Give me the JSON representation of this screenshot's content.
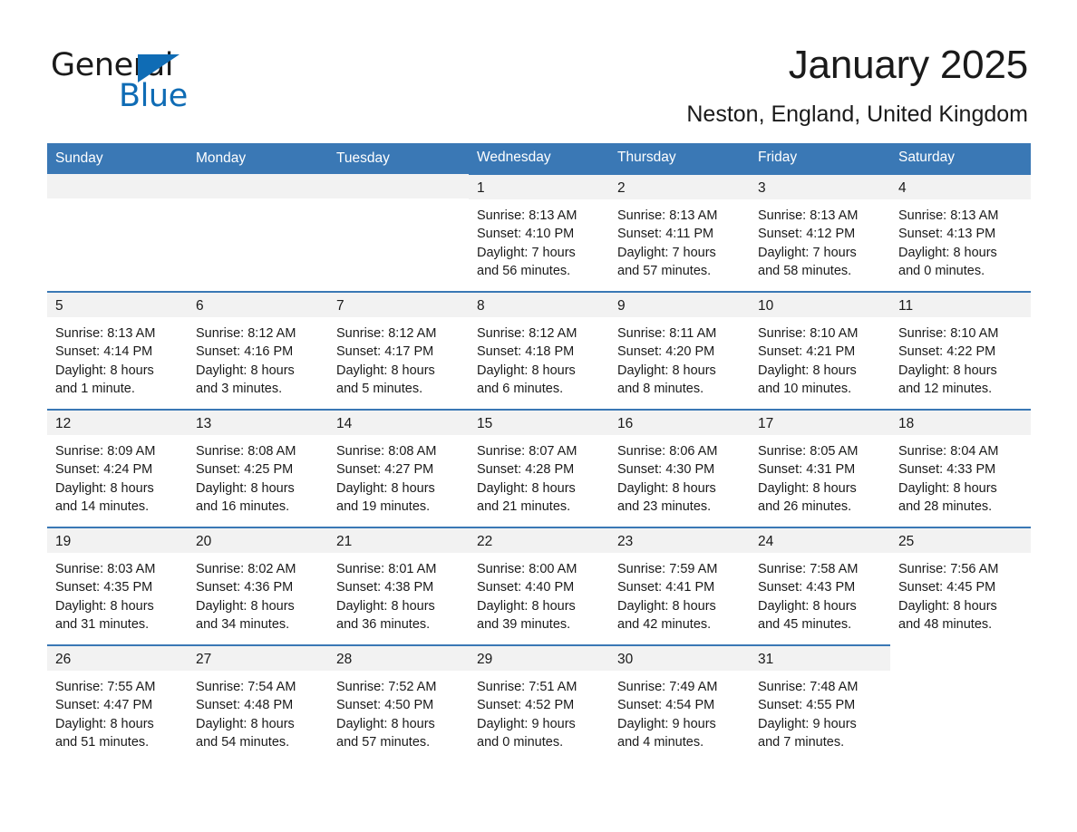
{
  "brand": {
    "name_part1": "General",
    "name_part2": "Blue",
    "triangle_color": "#0f6cb5"
  },
  "header": {
    "title": "January 2025",
    "subtitle": "Neston, England, United Kingdom"
  },
  "theme": {
    "header_blue": "#3a78b5",
    "daynum_band": "#f2f2f2",
    "text": "#1a1a1a"
  },
  "weekday_headers": [
    "Sunday",
    "Monday",
    "Tuesday",
    "Wednesday",
    "Thursday",
    "Friday",
    "Saturday"
  ],
  "weeks": [
    [
      {
        "blank": true
      },
      {
        "blank": true
      },
      {
        "blank": true
      },
      {
        "day": "1",
        "sunrise": "Sunrise: 8:13 AM",
        "sunset": "Sunset: 4:10 PM",
        "daylight1": "Daylight: 7 hours",
        "daylight2": "and 56 minutes."
      },
      {
        "day": "2",
        "sunrise": "Sunrise: 8:13 AM",
        "sunset": "Sunset: 4:11 PM",
        "daylight1": "Daylight: 7 hours",
        "daylight2": "and 57 minutes."
      },
      {
        "day": "3",
        "sunrise": "Sunrise: 8:13 AM",
        "sunset": "Sunset: 4:12 PM",
        "daylight1": "Daylight: 7 hours",
        "daylight2": "and 58 minutes."
      },
      {
        "day": "4",
        "sunrise": "Sunrise: 8:13 AM",
        "sunset": "Sunset: 4:13 PM",
        "daylight1": "Daylight: 8 hours",
        "daylight2": "and 0 minutes."
      }
    ],
    [
      {
        "day": "5",
        "sunrise": "Sunrise: 8:13 AM",
        "sunset": "Sunset: 4:14 PM",
        "daylight1": "Daylight: 8 hours",
        "daylight2": "and 1 minute."
      },
      {
        "day": "6",
        "sunrise": "Sunrise: 8:12 AM",
        "sunset": "Sunset: 4:16 PM",
        "daylight1": "Daylight: 8 hours",
        "daylight2": "and 3 minutes."
      },
      {
        "day": "7",
        "sunrise": "Sunrise: 8:12 AM",
        "sunset": "Sunset: 4:17 PM",
        "daylight1": "Daylight: 8 hours",
        "daylight2": "and 5 minutes."
      },
      {
        "day": "8",
        "sunrise": "Sunrise: 8:12 AM",
        "sunset": "Sunset: 4:18 PM",
        "daylight1": "Daylight: 8 hours",
        "daylight2": "and 6 minutes."
      },
      {
        "day": "9",
        "sunrise": "Sunrise: 8:11 AM",
        "sunset": "Sunset: 4:20 PM",
        "daylight1": "Daylight: 8 hours",
        "daylight2": "and 8 minutes."
      },
      {
        "day": "10",
        "sunrise": "Sunrise: 8:10 AM",
        "sunset": "Sunset: 4:21 PM",
        "daylight1": "Daylight: 8 hours",
        "daylight2": "and 10 minutes."
      },
      {
        "day": "11",
        "sunrise": "Sunrise: 8:10 AM",
        "sunset": "Sunset: 4:22 PM",
        "daylight1": "Daylight: 8 hours",
        "daylight2": "and 12 minutes."
      }
    ],
    [
      {
        "day": "12",
        "sunrise": "Sunrise: 8:09 AM",
        "sunset": "Sunset: 4:24 PM",
        "daylight1": "Daylight: 8 hours",
        "daylight2": "and 14 minutes."
      },
      {
        "day": "13",
        "sunrise": "Sunrise: 8:08 AM",
        "sunset": "Sunset: 4:25 PM",
        "daylight1": "Daylight: 8 hours",
        "daylight2": "and 16 minutes."
      },
      {
        "day": "14",
        "sunrise": "Sunrise: 8:08 AM",
        "sunset": "Sunset: 4:27 PM",
        "daylight1": "Daylight: 8 hours",
        "daylight2": "and 19 minutes."
      },
      {
        "day": "15",
        "sunrise": "Sunrise: 8:07 AM",
        "sunset": "Sunset: 4:28 PM",
        "daylight1": "Daylight: 8 hours",
        "daylight2": "and 21 minutes."
      },
      {
        "day": "16",
        "sunrise": "Sunrise: 8:06 AM",
        "sunset": "Sunset: 4:30 PM",
        "daylight1": "Daylight: 8 hours",
        "daylight2": "and 23 minutes."
      },
      {
        "day": "17",
        "sunrise": "Sunrise: 8:05 AM",
        "sunset": "Sunset: 4:31 PM",
        "daylight1": "Daylight: 8 hours",
        "daylight2": "and 26 minutes."
      },
      {
        "day": "18",
        "sunrise": "Sunrise: 8:04 AM",
        "sunset": "Sunset: 4:33 PM",
        "daylight1": "Daylight: 8 hours",
        "daylight2": "and 28 minutes."
      }
    ],
    [
      {
        "day": "19",
        "sunrise": "Sunrise: 8:03 AM",
        "sunset": "Sunset: 4:35 PM",
        "daylight1": "Daylight: 8 hours",
        "daylight2": "and 31 minutes."
      },
      {
        "day": "20",
        "sunrise": "Sunrise: 8:02 AM",
        "sunset": "Sunset: 4:36 PM",
        "daylight1": "Daylight: 8 hours",
        "daylight2": "and 34 minutes."
      },
      {
        "day": "21",
        "sunrise": "Sunrise: 8:01 AM",
        "sunset": "Sunset: 4:38 PM",
        "daylight1": "Daylight: 8 hours",
        "daylight2": "and 36 minutes."
      },
      {
        "day": "22",
        "sunrise": "Sunrise: 8:00 AM",
        "sunset": "Sunset: 4:40 PM",
        "daylight1": "Daylight: 8 hours",
        "daylight2": "and 39 minutes."
      },
      {
        "day": "23",
        "sunrise": "Sunrise: 7:59 AM",
        "sunset": "Sunset: 4:41 PM",
        "daylight1": "Daylight: 8 hours",
        "daylight2": "and 42 minutes."
      },
      {
        "day": "24",
        "sunrise": "Sunrise: 7:58 AM",
        "sunset": "Sunset: 4:43 PM",
        "daylight1": "Daylight: 8 hours",
        "daylight2": "and 45 minutes."
      },
      {
        "day": "25",
        "sunrise": "Sunrise: 7:56 AM",
        "sunset": "Sunset: 4:45 PM",
        "daylight1": "Daylight: 8 hours",
        "daylight2": "and 48 minutes."
      }
    ],
    [
      {
        "day": "26",
        "sunrise": "Sunrise: 7:55 AM",
        "sunset": "Sunset: 4:47 PM",
        "daylight1": "Daylight: 8 hours",
        "daylight2": "and 51 minutes."
      },
      {
        "day": "27",
        "sunrise": "Sunrise: 7:54 AM",
        "sunset": "Sunset: 4:48 PM",
        "daylight1": "Daylight: 8 hours",
        "daylight2": "and 54 minutes."
      },
      {
        "day": "28",
        "sunrise": "Sunrise: 7:52 AM",
        "sunset": "Sunset: 4:50 PM",
        "daylight1": "Daylight: 8 hours",
        "daylight2": "and 57 minutes."
      },
      {
        "day": "29",
        "sunrise": "Sunrise: 7:51 AM",
        "sunset": "Sunset: 4:52 PM",
        "daylight1": "Daylight: 9 hours",
        "daylight2": "and 0 minutes."
      },
      {
        "day": "30",
        "sunrise": "Sunrise: 7:49 AM",
        "sunset": "Sunset: 4:54 PM",
        "daylight1": "Daylight: 9 hours",
        "daylight2": "and 4 minutes."
      },
      {
        "day": "31",
        "sunrise": "Sunrise: 7:48 AM",
        "sunset": "Sunset: 4:55 PM",
        "daylight1": "Daylight: 9 hours",
        "daylight2": "and 7 minutes."
      },
      {
        "blank": true
      }
    ]
  ]
}
